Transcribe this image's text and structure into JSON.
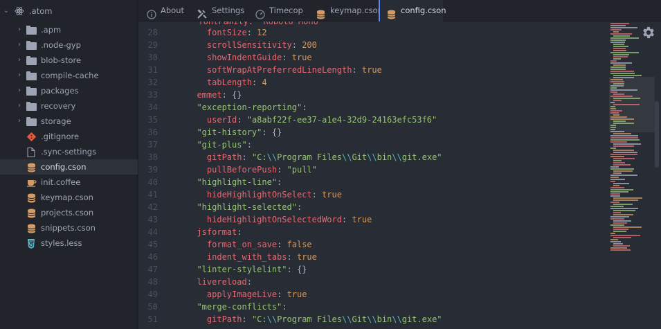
{
  "tree": {
    "root": {
      "label": ".atom"
    },
    "items": [
      {
        "label": ".apm",
        "kind": "folder"
      },
      {
        "label": ".node-gyp",
        "kind": "folder"
      },
      {
        "label": "blob-store",
        "kind": "folder"
      },
      {
        "label": "compile-cache",
        "kind": "folder"
      },
      {
        "label": "packages",
        "kind": "folder"
      },
      {
        "label": "recovery",
        "kind": "folder"
      },
      {
        "label": "storage",
        "kind": "folder"
      },
      {
        "label": ".gitignore",
        "kind": "git"
      },
      {
        "label": ".sync-settings",
        "kind": "file"
      },
      {
        "label": "config.cson",
        "kind": "cson",
        "selected": true
      },
      {
        "label": "init.coffee",
        "kind": "coffee"
      },
      {
        "label": "keymap.cson",
        "kind": "cson"
      },
      {
        "label": "projects.cson",
        "kind": "cson"
      },
      {
        "label": "snippets.cson",
        "kind": "cson"
      },
      {
        "label": "styles.less",
        "kind": "css"
      }
    ]
  },
  "tabs": [
    {
      "label": "About",
      "icon": "info-icon"
    },
    {
      "label": "Settings",
      "icon": "tools-icon"
    },
    {
      "label": "Timecop",
      "icon": "dashboard-icon"
    },
    {
      "label": "keymap.cson",
      "icon": "cson-icon"
    },
    {
      "label": "config.cson",
      "icon": "cson-icon",
      "active": true
    }
  ],
  "editor": {
    "partial_top": "  fontFamily: \"Roboto Mono\"",
    "lines": [
      {
        "n": "28",
        "t": [
          [
            "    ",
            ""
          ],
          [
            "fontSize",
            "k"
          ],
          [
            ": ",
            "p"
          ],
          [
            "12",
            "n"
          ]
        ]
      },
      {
        "n": "29",
        "t": [
          [
            "    ",
            ""
          ],
          [
            "scrollSensitivity",
            "k"
          ],
          [
            ": ",
            "p"
          ],
          [
            "200",
            "n"
          ]
        ]
      },
      {
        "n": "30",
        "t": [
          [
            "    ",
            ""
          ],
          [
            "showIndentGuide",
            "k"
          ],
          [
            ": ",
            "p"
          ],
          [
            "true",
            "n"
          ]
        ]
      },
      {
        "n": "31",
        "t": [
          [
            "    ",
            ""
          ],
          [
            "softWrapAtPreferredLineLength",
            "k"
          ],
          [
            ": ",
            "p"
          ],
          [
            "true",
            "n"
          ]
        ]
      },
      {
        "n": "32",
        "t": [
          [
            "    ",
            ""
          ],
          [
            "tabLength",
            "k"
          ],
          [
            ": ",
            "p"
          ],
          [
            "4",
            "n"
          ]
        ]
      },
      {
        "n": "33",
        "t": [
          [
            "  ",
            ""
          ],
          [
            "emmet",
            "k"
          ],
          [
            ": {}",
            "p"
          ]
        ]
      },
      {
        "n": "34",
        "t": [
          [
            "  ",
            ""
          ],
          [
            "\"exception-reporting\"",
            "s"
          ],
          [
            ":",
            "p"
          ]
        ]
      },
      {
        "n": "35",
        "t": [
          [
            "    ",
            ""
          ],
          [
            "userId",
            "k"
          ],
          [
            ": ",
            "p"
          ],
          [
            "\"a8abf22f-ee37-a1e4-32d9-24163efc53f6\"",
            "s"
          ]
        ]
      },
      {
        "n": "36",
        "t": [
          [
            "  ",
            ""
          ],
          [
            "\"git-history\"",
            "s"
          ],
          [
            ": {}",
            "p"
          ]
        ]
      },
      {
        "n": "37",
        "t": [
          [
            "  ",
            ""
          ],
          [
            "\"git-plus\"",
            "s"
          ],
          [
            ":",
            "p"
          ]
        ]
      },
      {
        "n": "38",
        "t": [
          [
            "    ",
            ""
          ],
          [
            "gitPath",
            "k"
          ],
          [
            ": ",
            "p"
          ],
          [
            "\"C:",
            "s"
          ],
          [
            "\\\\",
            "e"
          ],
          [
            "Program Files",
            "s"
          ],
          [
            "\\\\",
            "e"
          ],
          [
            "Git",
            "s"
          ],
          [
            "\\\\",
            "e"
          ],
          [
            "bin",
            "s"
          ],
          [
            "\\\\",
            "e"
          ],
          [
            "git.exe\"",
            "s"
          ]
        ]
      },
      {
        "n": "39",
        "t": [
          [
            "    ",
            ""
          ],
          [
            "pullBeforePush",
            "k"
          ],
          [
            ": ",
            "p"
          ],
          [
            "\"pull\"",
            "s"
          ]
        ]
      },
      {
        "n": "40",
        "t": [
          [
            "  ",
            ""
          ],
          [
            "\"highlight-line\"",
            "s"
          ],
          [
            ":",
            "p"
          ]
        ]
      },
      {
        "n": "41",
        "t": [
          [
            "    ",
            ""
          ],
          [
            "hideHighlightOnSelect",
            "k"
          ],
          [
            ": ",
            "p"
          ],
          [
            "true",
            "n"
          ]
        ]
      },
      {
        "n": "42",
        "t": [
          [
            "  ",
            ""
          ],
          [
            "\"highlight-selected\"",
            "s"
          ],
          [
            ":",
            "p"
          ]
        ]
      },
      {
        "n": "43",
        "t": [
          [
            "    ",
            ""
          ],
          [
            "hideHighlightOnSelectedWord",
            "k"
          ],
          [
            ": ",
            "p"
          ],
          [
            "true",
            "n"
          ]
        ]
      },
      {
        "n": "44",
        "t": [
          [
            "  ",
            ""
          ],
          [
            "jsformat",
            "k"
          ],
          [
            ":",
            "p"
          ]
        ]
      },
      {
        "n": "45",
        "t": [
          [
            "    ",
            ""
          ],
          [
            "format_on_save",
            "k"
          ],
          [
            ": ",
            "p"
          ],
          [
            "false",
            "n"
          ]
        ]
      },
      {
        "n": "46",
        "t": [
          [
            "    ",
            ""
          ],
          [
            "indent_with_tabs",
            "k"
          ],
          [
            ": ",
            "p"
          ],
          [
            "true",
            "n"
          ]
        ]
      },
      {
        "n": "47",
        "t": [
          [
            "  ",
            ""
          ],
          [
            "\"linter-stylelint\"",
            "s"
          ],
          [
            ": {}",
            "p"
          ]
        ]
      },
      {
        "n": "48",
        "t": [
          [
            "  ",
            ""
          ],
          [
            "livereload",
            "k"
          ],
          [
            ":",
            "p"
          ]
        ]
      },
      {
        "n": "49",
        "t": [
          [
            "    ",
            ""
          ],
          [
            "applyImageLive",
            "k"
          ],
          [
            ": ",
            "p"
          ],
          [
            "true",
            "n"
          ]
        ]
      },
      {
        "n": "50",
        "t": [
          [
            "  ",
            ""
          ],
          [
            "\"merge-conflicts\"",
            "s"
          ],
          [
            ":",
            "p"
          ]
        ]
      },
      {
        "n": "51",
        "t": [
          [
            "    ",
            ""
          ],
          [
            "gitPath",
            "k"
          ],
          [
            ": ",
            "p"
          ],
          [
            "\"C:",
            "s"
          ],
          [
            "\\\\",
            "e"
          ],
          [
            "Program Files",
            "s"
          ],
          [
            "\\\\",
            "e"
          ],
          [
            "Git",
            "s"
          ],
          [
            "\\\\",
            "e"
          ],
          [
            "bin",
            "s"
          ],
          [
            "\\\\",
            "e"
          ],
          [
            "git.exe\"",
            "s"
          ]
        ]
      }
    ]
  },
  "colors": {
    "accent": "#568af2",
    "keyword": "#e06c75",
    "string": "#98c379",
    "number": "#d19a66",
    "cson_icon": "#d19a66",
    "git_icon": "#e05d44",
    "css_icon": "#56b6c2"
  }
}
